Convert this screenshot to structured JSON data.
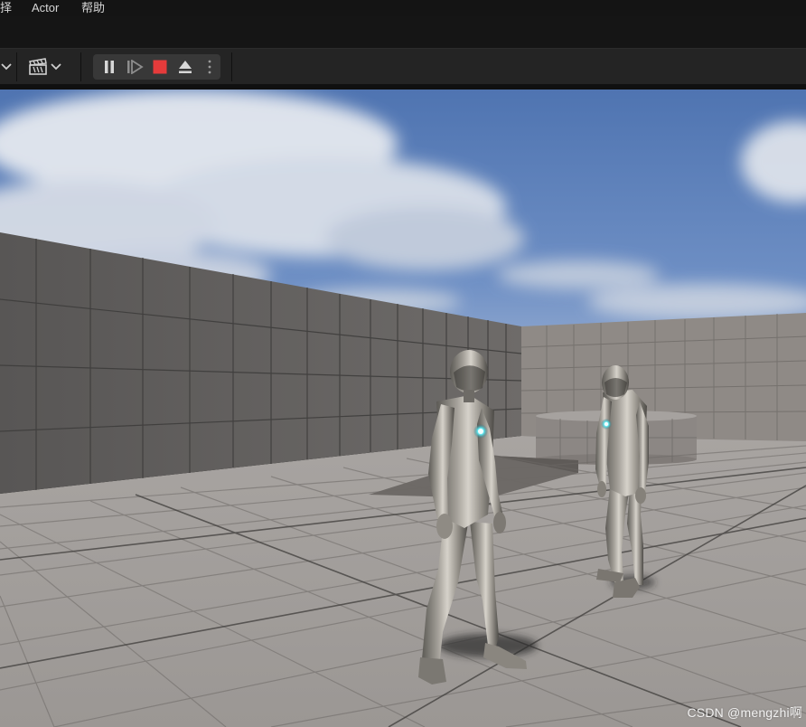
{
  "menu": {
    "items": [
      "择",
      "Actor",
      "帮助"
    ]
  },
  "toolbar": {
    "icons": [
      "chevron-down-icon",
      "clapperboard-icon",
      "chevron-down-icon",
      "pause-icon",
      "step-frame-icon",
      "stop-icon",
      "eject-icon",
      "more-options-icon"
    ],
    "stop_color": "#e53b3b"
  },
  "viewport": {
    "scene": "level-viewport",
    "sky_color": "#5a7db8",
    "floor_color": "#9f9b98",
    "wall_color": "#5a5857"
  },
  "watermark": {
    "text": "CSDN @mengzhi啊"
  }
}
